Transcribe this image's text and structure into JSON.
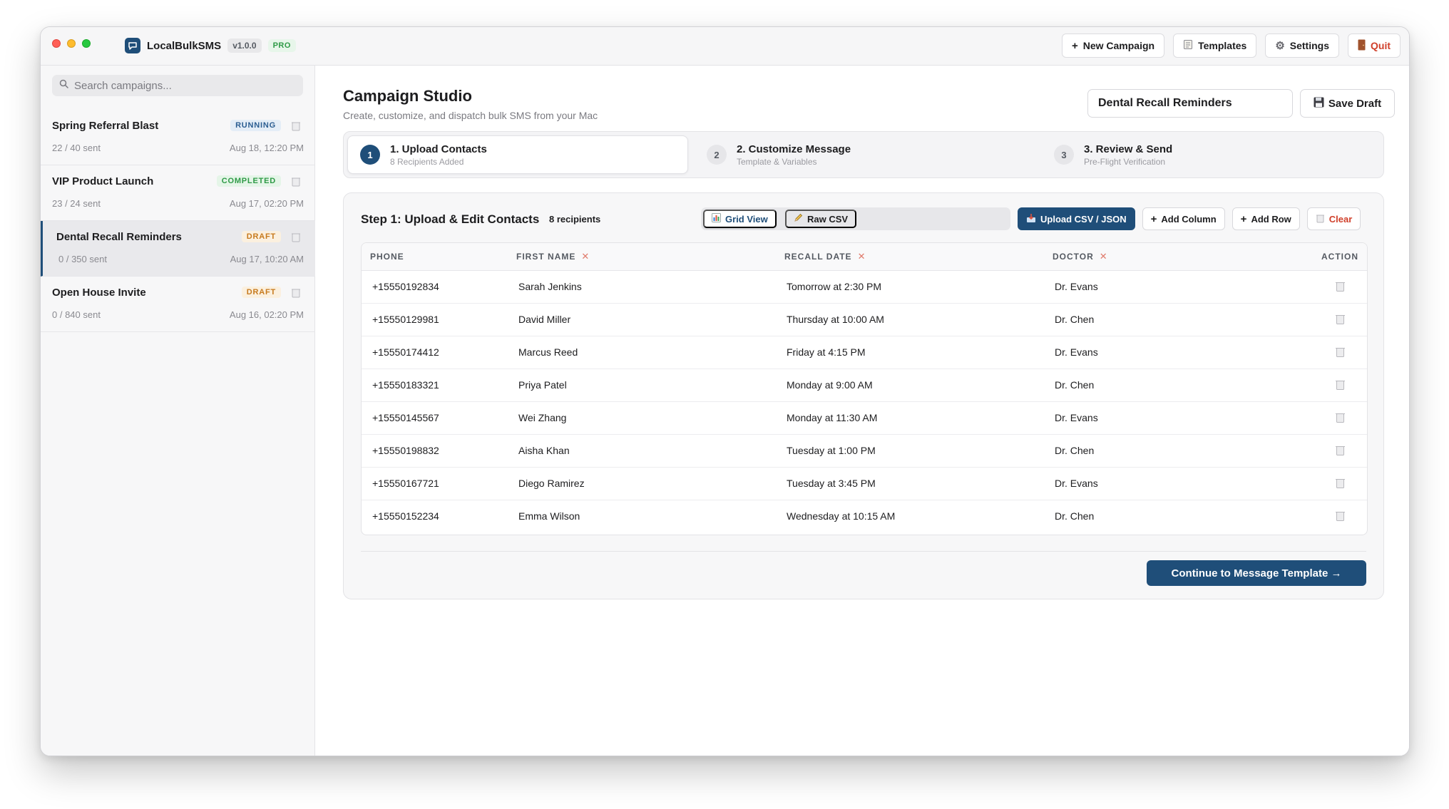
{
  "app": {
    "name": "LocalBulkSMS",
    "version": "v1.0.0",
    "plan": "PRO"
  },
  "titlebar": {
    "new_campaign": "New Campaign",
    "templates": "Templates",
    "settings": "Settings",
    "quit": "Quit"
  },
  "sidebar": {
    "search_placeholder": "Search campaigns...",
    "campaigns": [
      {
        "name": "Spring Referral Blast",
        "status": "RUNNING",
        "sent": "22 / 40 sent",
        "date": "Aug 18, 12:20 PM"
      },
      {
        "name": "VIP Product Launch",
        "status": "COMPLETED",
        "sent": "23 / 24 sent",
        "date": "Aug 17, 02:20 PM"
      },
      {
        "name": "Dental Recall Reminders",
        "status": "DRAFT",
        "sent": "0 / 350 sent",
        "date": "Aug 17, 10:20 AM"
      },
      {
        "name": "Open House Invite",
        "status": "DRAFT",
        "sent": "0 / 840 sent",
        "date": "Aug 16, 02:20 PM"
      }
    ]
  },
  "header": {
    "title": "Campaign Studio",
    "subtitle": "Create, customize, and dispatch bulk SMS from your Mac",
    "campaign_name": "Dental Recall Reminders",
    "save_draft": "Save Draft"
  },
  "steps": [
    {
      "num": "1",
      "title": "1. Upload Contacts",
      "subtitle": "8 Recipients Added"
    },
    {
      "num": "2",
      "title": "2. Customize Message",
      "subtitle": "Template & Variables"
    },
    {
      "num": "3",
      "title": "3. Review & Send",
      "subtitle": "Pre-Flight Verification"
    }
  ],
  "card": {
    "title": "Step 1: Upload & Edit Contacts",
    "count": "8 recipients",
    "grid_view": "Grid View",
    "raw_csv": "Raw CSV",
    "upload": "Upload CSV / JSON",
    "add_column": "Add Column",
    "add_row": "Add Row",
    "clear": "Clear",
    "continue": "Continue to Message Template →"
  },
  "table": {
    "headers": {
      "phone": "PHONE",
      "first_name": "FIRST NAME",
      "recall_date": "RECALL DATE",
      "doctor": "DOCTOR",
      "action": "ACTION"
    },
    "rows": [
      {
        "phone": "+15550192834",
        "first": "Sarah Jenkins",
        "recall": "Tomorrow at 2:30 PM",
        "doctor": "Dr. Evans"
      },
      {
        "phone": "+15550129981",
        "first": "David Miller",
        "recall": "Thursday at 10:00 AM",
        "doctor": "Dr. Chen"
      },
      {
        "phone": "+15550174412",
        "first": "Marcus Reed",
        "recall": "Friday at 4:15 PM",
        "doctor": "Dr. Evans"
      },
      {
        "phone": "+15550183321",
        "first": "Priya Patel",
        "recall": "Monday at 9:00 AM",
        "doctor": "Dr. Chen"
      },
      {
        "phone": "+15550145567",
        "first": "Wei Zhang",
        "recall": "Monday at 11:30 AM",
        "doctor": "Dr. Evans"
      },
      {
        "phone": "+15550198832",
        "first": "Aisha Khan",
        "recall": "Tuesday at 1:00 PM",
        "doctor": "Dr. Chen"
      },
      {
        "phone": "+15550167721",
        "first": "Diego Ramirez",
        "recall": "Tuesday at 3:45 PM",
        "doctor": "Dr. Evans"
      },
      {
        "phone": "+15550152234",
        "first": "Emma Wilson",
        "recall": "Wednesday at 10:15 AM",
        "doctor": "Dr. Chen"
      }
    ]
  },
  "colors": {
    "accent": "#1f4e79",
    "danger": "#d0402b",
    "success": "#2e9a46",
    "warning": "#c77a1d"
  }
}
